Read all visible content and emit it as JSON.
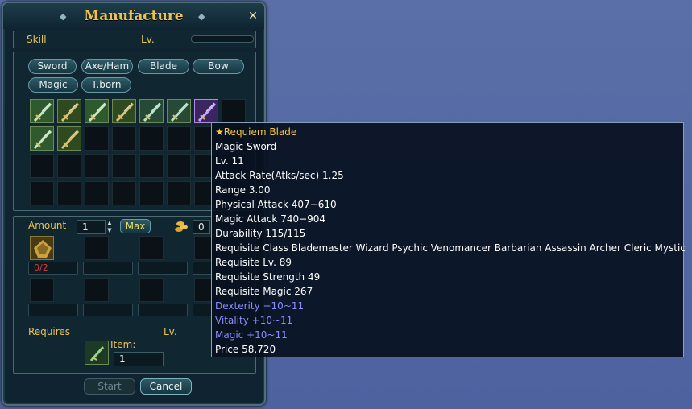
{
  "window": {
    "title": "Manufacture",
    "close_glyph": "✕",
    "ornament_glyph": "◆"
  },
  "skill": {
    "label": "Skill",
    "level_label": "Lv."
  },
  "categories": [
    {
      "label": "Sword"
    },
    {
      "label": "Axe/Ham"
    },
    {
      "label": "Blade"
    },
    {
      "label": "Bow"
    },
    {
      "label": "Magic"
    },
    {
      "label": "T.born"
    }
  ],
  "recipe_items": [
    {
      "icon": "sword-recipe-icon"
    },
    {
      "icon": "blade-recipe-icon"
    },
    {
      "icon": "sword-recipe-icon"
    },
    {
      "icon": "blade-recipe-icon"
    },
    {
      "icon": "trident-recipe-icon"
    },
    {
      "icon": "trident-recipe-icon"
    },
    {
      "icon": "requiem-blade-icon"
    },
    {
      "icon": "sword-recipe-icon"
    },
    {
      "icon": "blade-recipe-icon"
    }
  ],
  "amount": {
    "label": "Amount",
    "value": "1",
    "max_label": "Max",
    "gold_value": "0",
    "gold_icon": "gold-coins-icon"
  },
  "material": {
    "icon": "material-ore-icon",
    "count": "0/2"
  },
  "requires": {
    "label": "Requires",
    "level_label": "Lv.",
    "item_label": "Item:",
    "item_value": "1",
    "item_icon": "catalyst-item-icon"
  },
  "buttons": {
    "start": "Start",
    "cancel": "Cancel"
  },
  "tooltip": {
    "lines": [
      {
        "text": "★Requiem Blade",
        "color": "#f5c842"
      },
      {
        "text": "Magic Sword",
        "color": "#ffffff"
      },
      {
        "text": "Lv. 11",
        "color": "#ffffff"
      },
      {
        "text": "Attack Rate(Atks/sec) 1.25",
        "color": "#ffffff"
      },
      {
        "text": "Range 3.00",
        "color": "#ffffff"
      },
      {
        "text": "Physical Attack 407−610",
        "color": "#ffffff"
      },
      {
        "text": "Magic Attack 740−904",
        "color": "#ffffff"
      },
      {
        "text": "Durability 115/115",
        "color": "#ffffff"
      },
      {
        "text": "Requisite Class Blademaster Wizard Psychic Venomancer Barbarian Assassin Archer Cleric Mystic",
        "color": "#ffffff"
      },
      {
        "text": "Requisite Lv. 89",
        "color": "#ffffff"
      },
      {
        "text": "Requisite Strength 49",
        "color": "#ffffff"
      },
      {
        "text": "Requisite Magic 267",
        "color": "#ffffff"
      },
      {
        "text": "Dexterity +10~11",
        "color": "#8a8cff"
      },
      {
        "text": "Vitality +10~11",
        "color": "#8a8cff"
      },
      {
        "text": "Magic +10~11",
        "color": "#8a8cff"
      },
      {
        "text": "Price 58,720",
        "color": "#ffffff"
      }
    ]
  }
}
